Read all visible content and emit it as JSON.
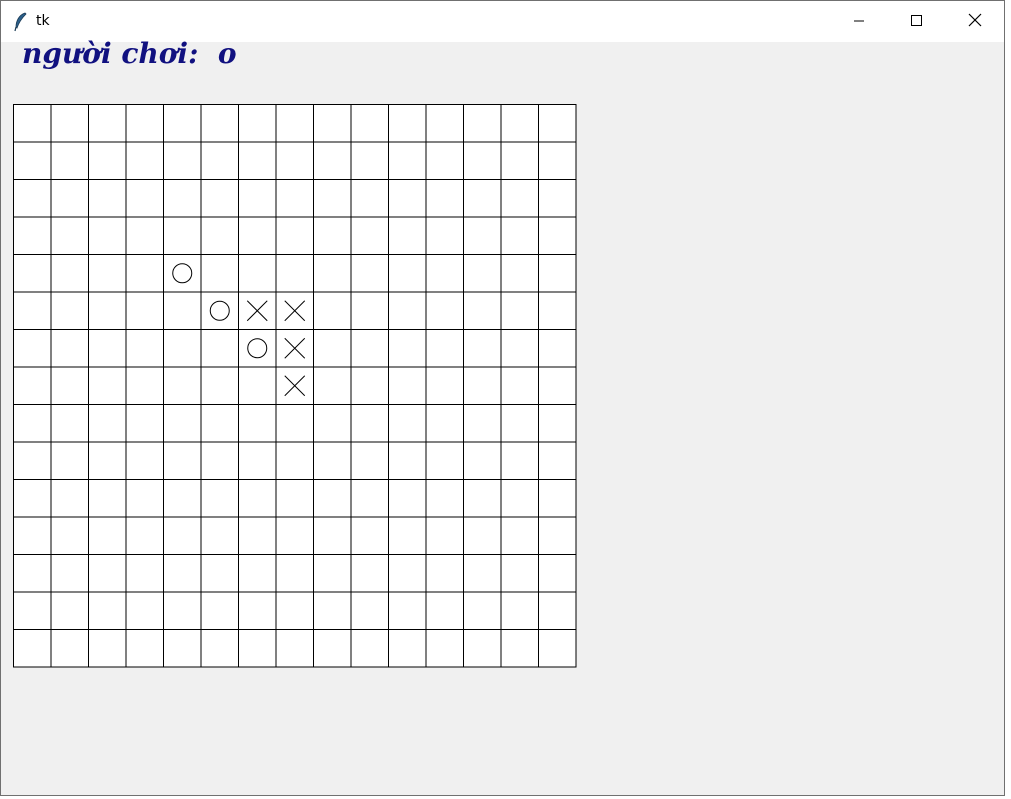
{
  "window": {
    "title": "tk",
    "app_icon": "feather-icon",
    "controls": [
      "minimize-icon",
      "maximize-icon",
      "close-icon"
    ]
  },
  "status": {
    "label": "người chơi:  o"
  },
  "board": {
    "rows": 15,
    "cols": 15,
    "pieces": [
      {
        "row": 4,
        "col": 4,
        "mark": "O"
      },
      {
        "row": 5,
        "col": 5,
        "mark": "O"
      },
      {
        "row": 5,
        "col": 6,
        "mark": "X"
      },
      {
        "row": 5,
        "col": 7,
        "mark": "X"
      },
      {
        "row": 6,
        "col": 6,
        "mark": "O"
      },
      {
        "row": 6,
        "col": 7,
        "mark": "X"
      },
      {
        "row": 7,
        "col": 7,
        "mark": "X"
      }
    ]
  }
}
